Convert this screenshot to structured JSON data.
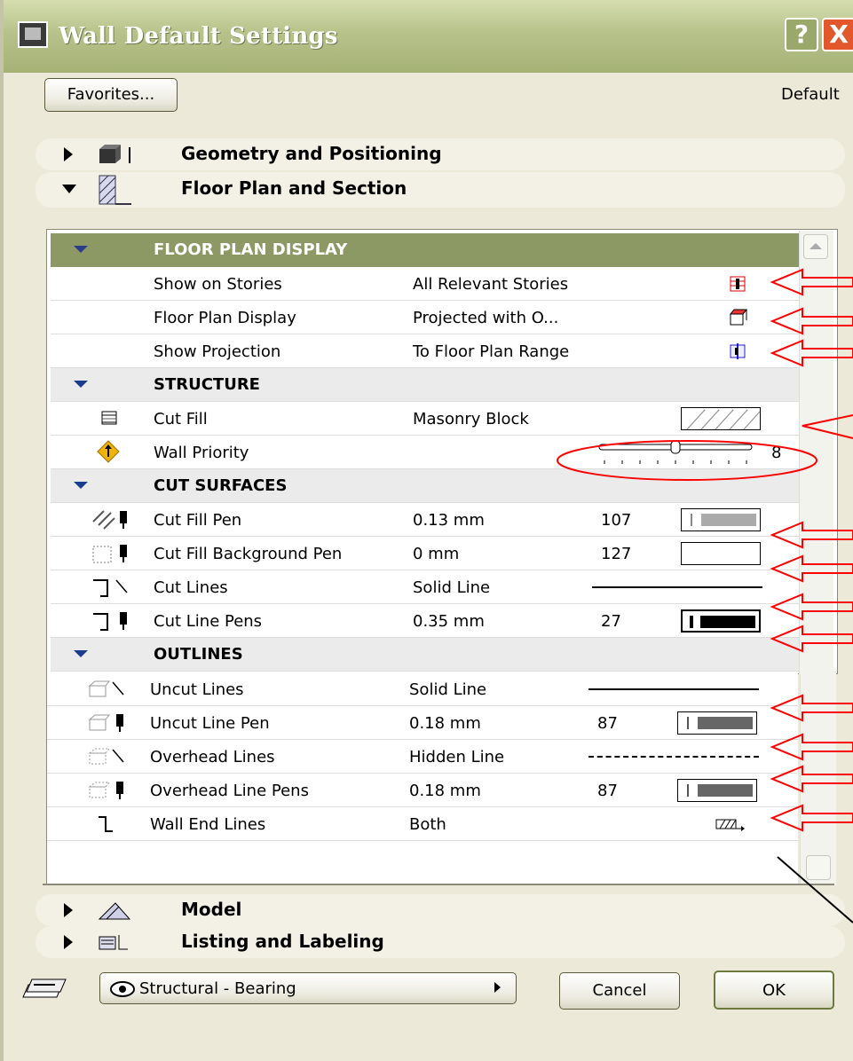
{
  "window": {
    "title": "Wall Default Settings",
    "help_label": "?",
    "close_label": "X"
  },
  "toolbar": {
    "favorites_label": "Favorites...",
    "default_label": "Default"
  },
  "sections": {
    "geometry": "Geometry and Positioning",
    "floorplan": "Floor Plan and Section",
    "model": "Model",
    "listing": "Listing and Labeling"
  },
  "panel": {
    "groups": {
      "floor_plan_display": "FLOOR PLAN DISPLAY",
      "structure": "STRUCTURE",
      "cut_surfaces": "CUT SURFACES",
      "outlines": "OUTLINES"
    },
    "rows": [
      {
        "name": "Show on Stories",
        "value": "All Relevant Stories",
        "num": ""
      },
      {
        "name": "Floor Plan Display",
        "value": "Projected with O...",
        "num": ""
      },
      {
        "name": "Show Projection",
        "value": "To Floor Plan Range",
        "num": ""
      },
      {
        "name": "Cut Fill",
        "value": "Masonry Block",
        "num": ""
      },
      {
        "name": "Wall Priority",
        "value": "",
        "num": "8"
      },
      {
        "name": "Cut Fill Pen",
        "value": "0.13 mm",
        "num": "107"
      },
      {
        "name": "Cut Fill Background Pen",
        "value": "0 mm",
        "num": "127"
      },
      {
        "name": "Cut Lines",
        "value": "Solid Line",
        "num": ""
      },
      {
        "name": "Cut Line Pens",
        "value": "0.35 mm",
        "num": "27"
      },
      {
        "name": "Uncut Lines",
        "value": "Solid Line",
        "num": ""
      },
      {
        "name": "Uncut Line Pen",
        "value": "0.18 mm",
        "num": "87"
      },
      {
        "name": "Overhead Lines",
        "value": "Hidden Line",
        "num": ""
      },
      {
        "name": "Overhead Line Pens",
        "value": "0.18 mm",
        "num": "87"
      },
      {
        "name": "Wall End Lines",
        "value": "Both",
        "num": ""
      }
    ],
    "wall_priority_slider_fraction": 0.5
  },
  "footer": {
    "layer_label": "Structural - Bearing",
    "cancel_label": "Cancel",
    "ok_label": "OK"
  },
  "colors": {
    "titlebar": "#b6c28a",
    "header_green": "#8c9965",
    "close_red": "#e2572c",
    "annotation_red": "#ff0000"
  }
}
